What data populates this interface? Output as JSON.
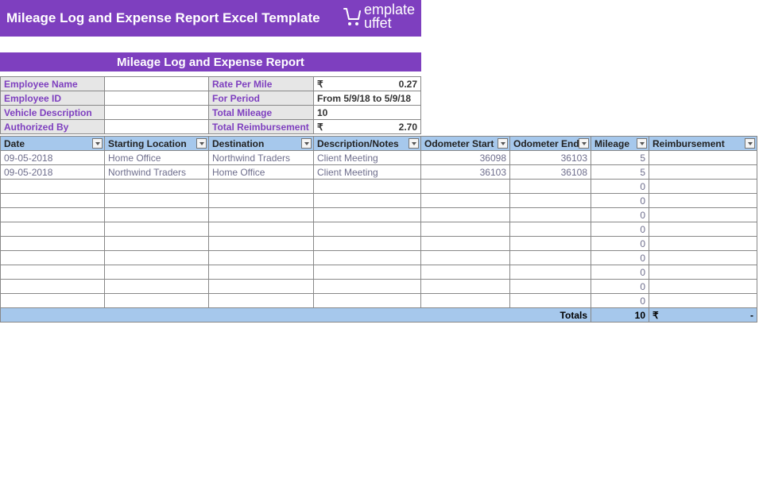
{
  "header": {
    "main_title": "Mileage Log and Expense Report Excel Template",
    "brand_prefix": "emplate",
    "brand_suffix": "uffet",
    "subtitle": "Mileage Log and Expense Report"
  },
  "info": {
    "employee_name_lbl": "Employee Name",
    "employee_name_val": "",
    "rate_per_mile_lbl": "Rate Per Mile",
    "rate_per_mile_val": "0.27",
    "employee_id_lbl": "Employee ID",
    "employee_id_val": "",
    "for_period_lbl": "For Period",
    "for_period_val": "From 5/9/18 to 5/9/18",
    "vehicle_desc_lbl": "Vehicle Description",
    "vehicle_desc_val": "",
    "total_mileage_lbl": "Total Mileage",
    "total_mileage_val": "10",
    "authorized_by_lbl": "Authorized By",
    "authorized_by_val": "",
    "total_reimb_lbl": "Total Reimbursement",
    "total_reimb_val": "2.70",
    "currency": "₹"
  },
  "columns": {
    "date": "Date",
    "start_loc": "Starting Location",
    "destination": "Destination",
    "desc_notes": "Description/Notes",
    "odo_start": "Odometer Start",
    "odo_end": "Odometer End",
    "mileage": "Mileage",
    "reimb": "Reimbursement"
  },
  "rows": [
    {
      "date": "09-05-2018",
      "start": "Home Office",
      "dest": "Northwind Traders",
      "desc": "Client Meeting",
      "odo1": "36098",
      "odo2": "36103",
      "mile": "5",
      "reimb": ""
    },
    {
      "date": "09-05-2018",
      "start": "Northwind Traders",
      "dest": "Home Office",
      "desc": "Client Meeting",
      "odo1": "36103",
      "odo2": "36108",
      "mile": "5",
      "reimb": ""
    },
    {
      "date": "",
      "start": "",
      "dest": "",
      "desc": "",
      "odo1": "",
      "odo2": "",
      "mile": "0",
      "reimb": ""
    },
    {
      "date": "",
      "start": "",
      "dest": "",
      "desc": "",
      "odo1": "",
      "odo2": "",
      "mile": "0",
      "reimb": ""
    },
    {
      "date": "",
      "start": "",
      "dest": "",
      "desc": "",
      "odo1": "",
      "odo2": "",
      "mile": "0",
      "reimb": ""
    },
    {
      "date": "",
      "start": "",
      "dest": "",
      "desc": "",
      "odo1": "",
      "odo2": "",
      "mile": "0",
      "reimb": ""
    },
    {
      "date": "",
      "start": "",
      "dest": "",
      "desc": "",
      "odo1": "",
      "odo2": "",
      "mile": "0",
      "reimb": ""
    },
    {
      "date": "",
      "start": "",
      "dest": "",
      "desc": "",
      "odo1": "",
      "odo2": "",
      "mile": "0",
      "reimb": ""
    },
    {
      "date": "",
      "start": "",
      "dest": "",
      "desc": "",
      "odo1": "",
      "odo2": "",
      "mile": "0",
      "reimb": ""
    },
    {
      "date": "",
      "start": "",
      "dest": "",
      "desc": "",
      "odo1": "",
      "odo2": "",
      "mile": "0",
      "reimb": ""
    },
    {
      "date": "",
      "start": "",
      "dest": "",
      "desc": "",
      "odo1": "",
      "odo2": "",
      "mile": "0",
      "reimb": ""
    }
  ],
  "totals": {
    "label": "Totals",
    "mileage": "10",
    "currency": "₹",
    "reimb": "-"
  }
}
